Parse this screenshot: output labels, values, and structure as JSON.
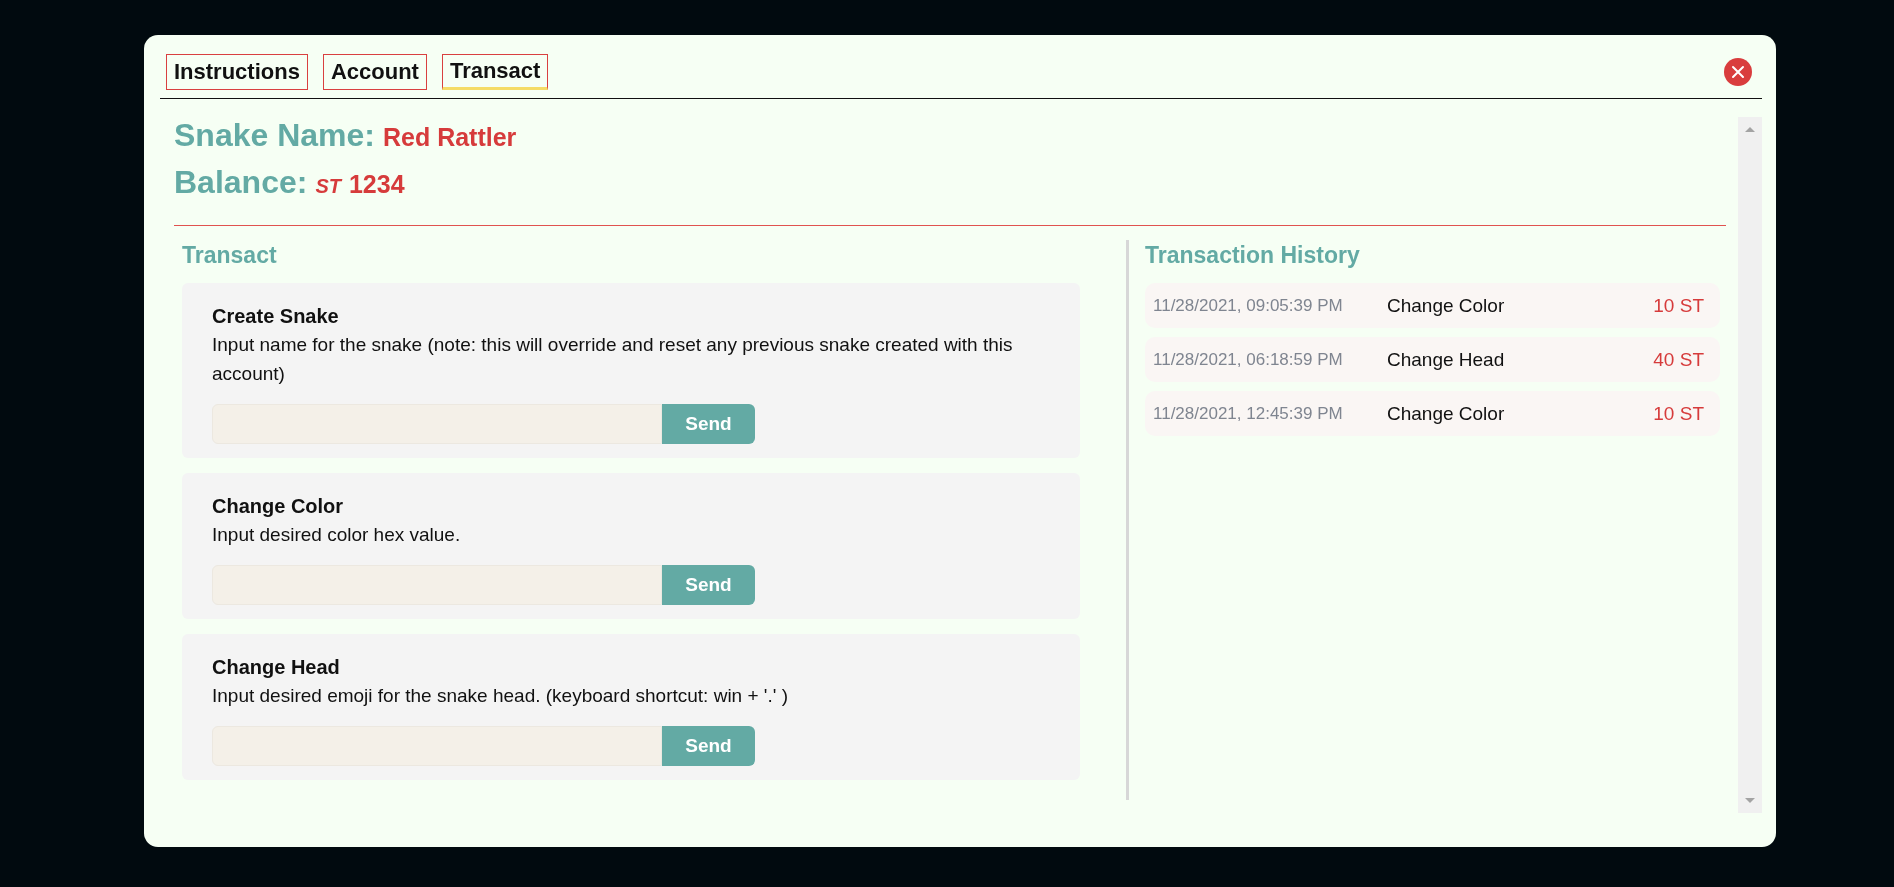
{
  "tabs": [
    {
      "label": "Instructions",
      "selected": false
    },
    {
      "label": "Account",
      "selected": false
    },
    {
      "label": "Transact",
      "selected": true
    }
  ],
  "snake_name": {
    "label": "Snake Name:",
    "value": "Red Rattler"
  },
  "balance": {
    "label": "Balance:",
    "currency": "ST",
    "value": "1234"
  },
  "transact": {
    "title": "Transact",
    "forms": [
      {
        "title": "Create Snake",
        "description": "Input name for the snake (note: this will override and reset any previous snake created with this account)",
        "button": "Send"
      },
      {
        "title": "Change Color",
        "description": "Input desired color hex value.",
        "button": "Send"
      },
      {
        "title": "Change Head",
        "description": "Input desired emoji for the snake head. (keyboard shortcut: win + '.' )",
        "button": "Send"
      }
    ]
  },
  "history": {
    "title": "Transaction History",
    "rows": [
      {
        "time": "11/28/2021, 09:05:39 PM",
        "action": "Change Color",
        "amount": "10 ST"
      },
      {
        "time": "11/28/2021, 06:18:59 PM",
        "action": "Change Head",
        "amount": "40 ST"
      },
      {
        "time": "11/28/2021, 12:45:39 PM",
        "action": "Change Color",
        "amount": "10 ST"
      }
    ]
  }
}
